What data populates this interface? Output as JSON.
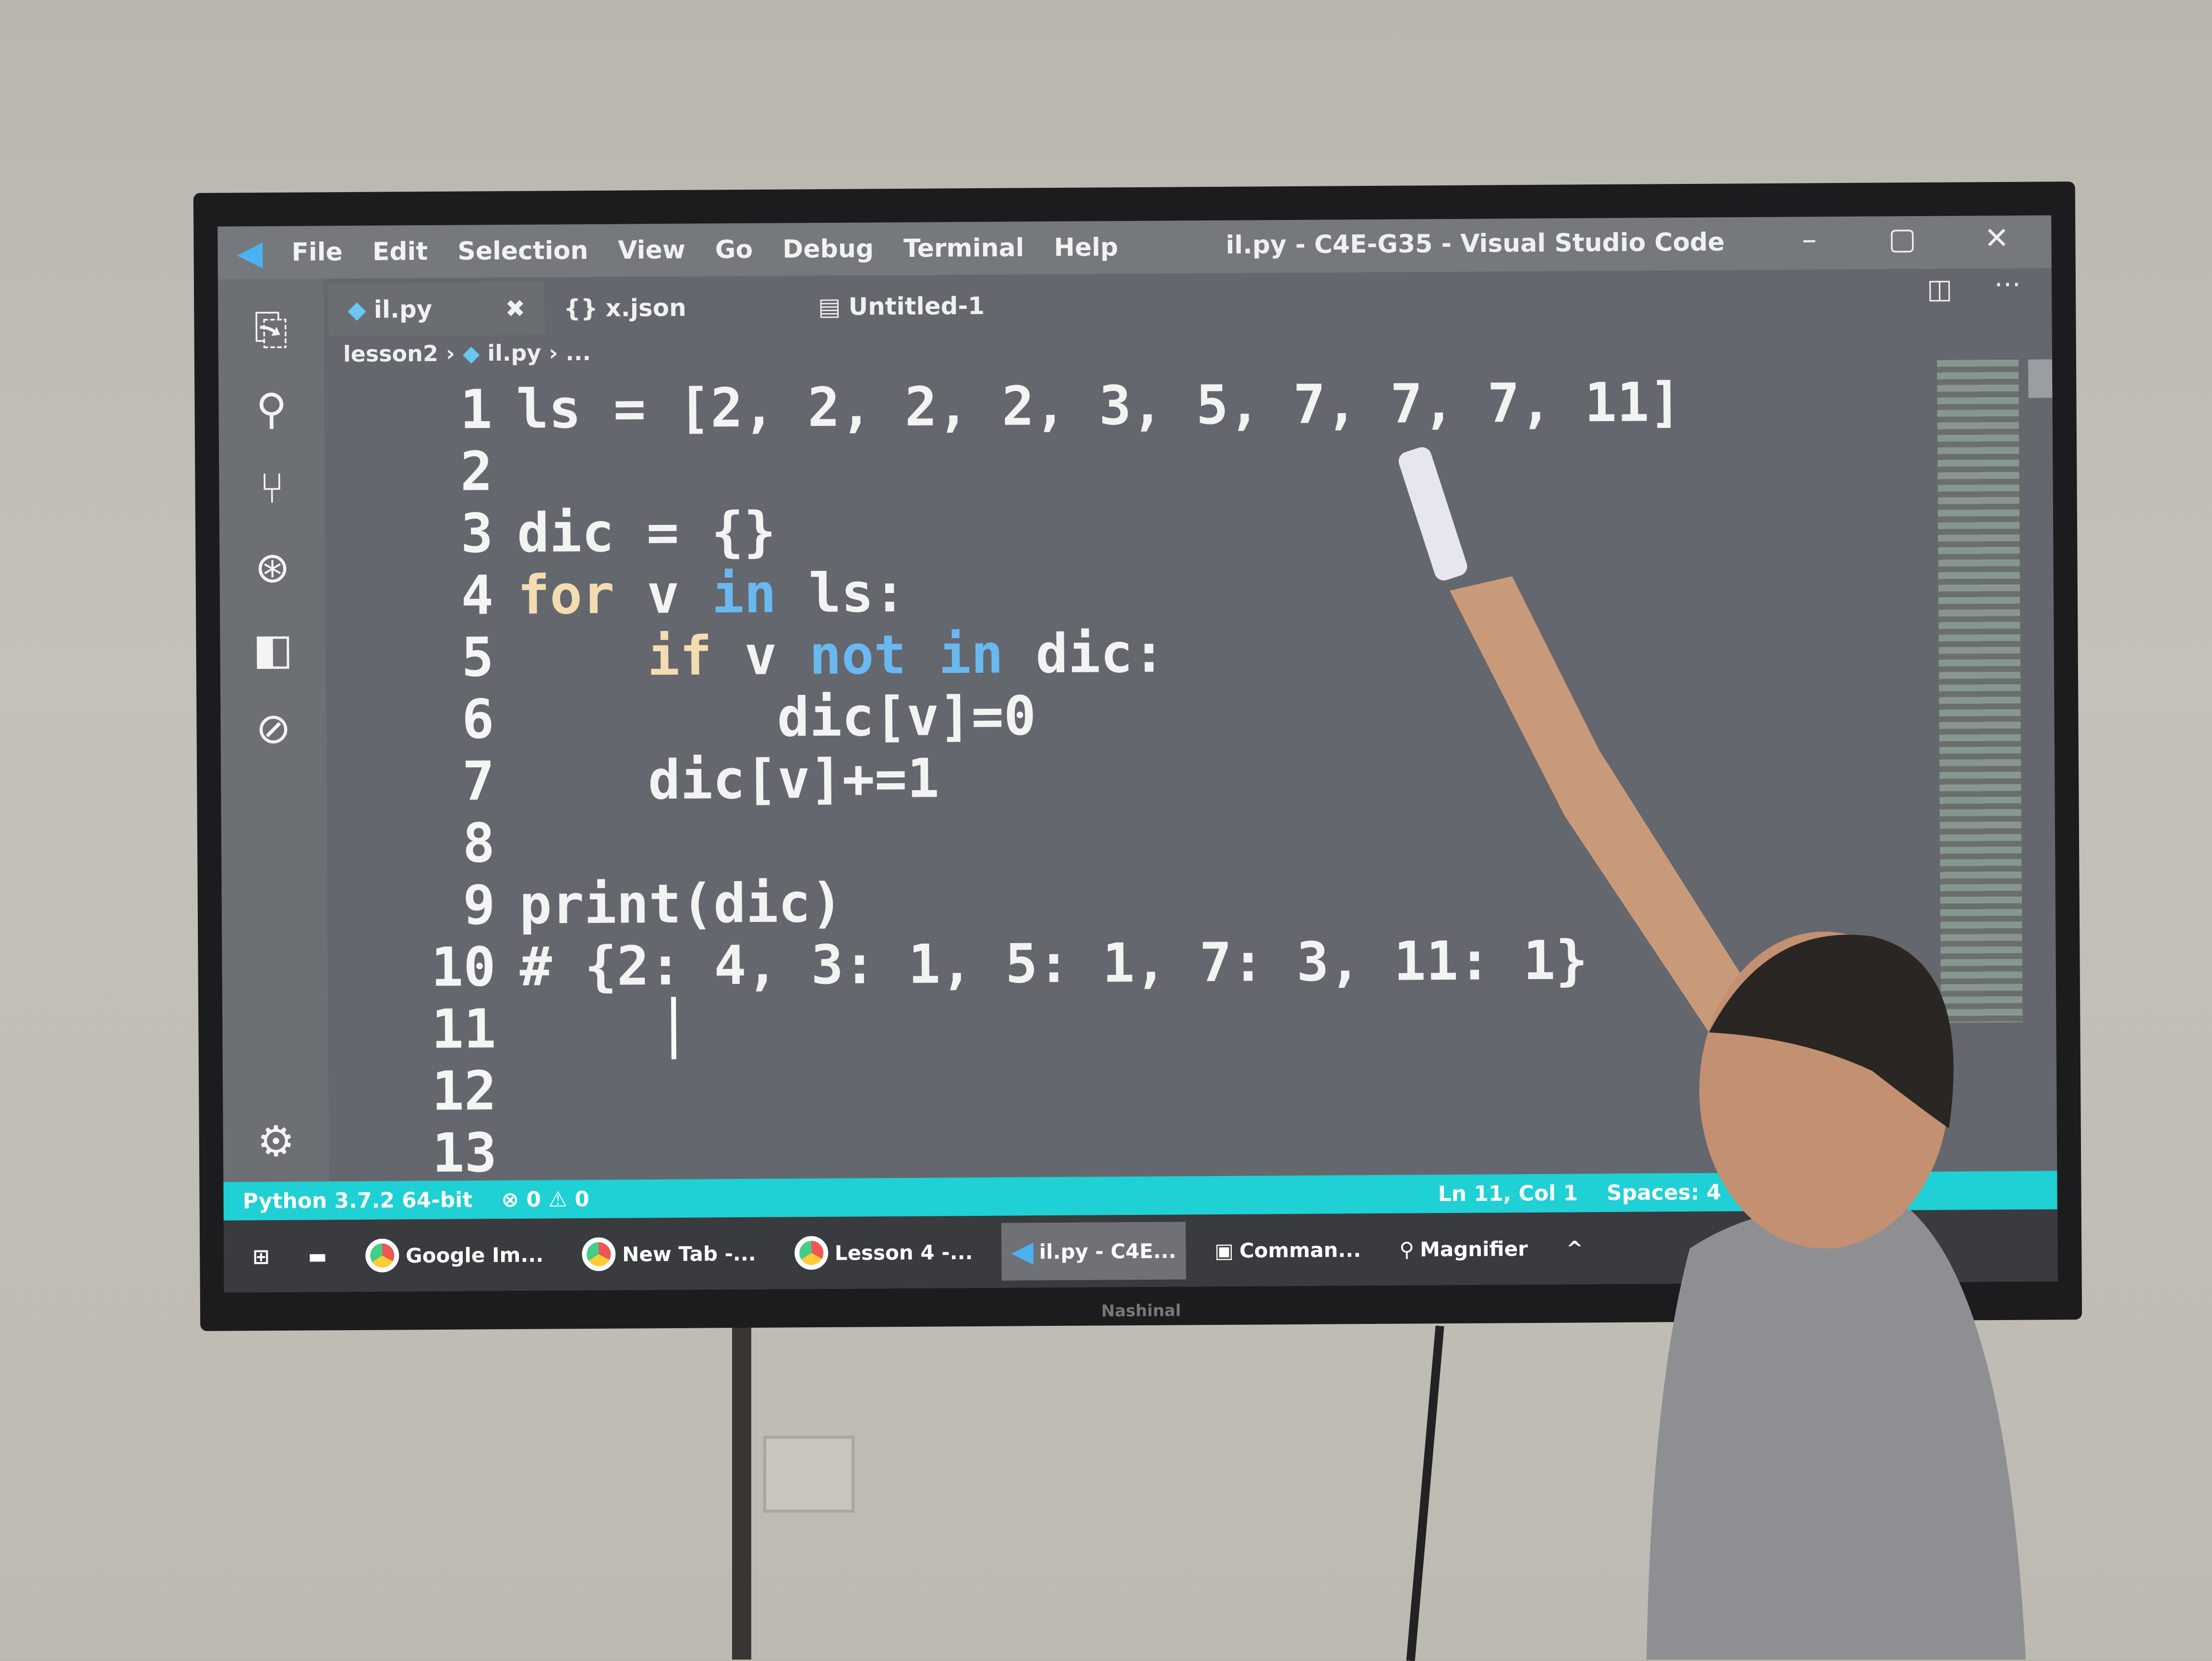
{
  "window": {
    "title": "il.py - C4E-G35 - Visual Studio Code",
    "menu": [
      "File",
      "Edit",
      "Selection",
      "View",
      "Go",
      "Debug",
      "Terminal",
      "Help"
    ]
  },
  "tabs": [
    {
      "label": "il.py",
      "icon": "python-file-icon",
      "active": true
    },
    {
      "label": "x.json",
      "icon": "json-braces-icon"
    },
    {
      "label": "Untitled-1",
      "icon": "file-icon"
    }
  ],
  "breadcrumb": [
    "lesson2",
    "il.py",
    "..."
  ],
  "activity_icons": [
    "explorer-icon",
    "search-icon",
    "source-control-icon",
    "debug-icon",
    "extensions-icon",
    "live-share-icon",
    "settings-gear-icon"
  ],
  "code": [
    {
      "n": "1",
      "t": "ls = [2, 2, 2, 2, 3, 5, 7, 7, 7, 11]"
    },
    {
      "n": "2",
      "t": ""
    },
    {
      "n": "3",
      "t": "dic = {}"
    },
    {
      "n": "4",
      "kw": "for",
      "a": " v ",
      "kb": "in",
      "b": " ls:"
    },
    {
      "n": "5",
      "indent": "    ",
      "kw": "if",
      "a": " v ",
      "kb": "not in",
      "b": " dic:"
    },
    {
      "n": "6",
      "t": "        dic[v]=0"
    },
    {
      "n": "7",
      "t": "    dic[v]+=1"
    },
    {
      "n": "8",
      "t": ""
    },
    {
      "n": "9",
      "t": "print(dic)"
    },
    {
      "n": "10",
      "t": "# {2: 4, 3: 1, 5: 1, 7: 3, 11: 1}"
    },
    {
      "n": "11",
      "t": ""
    },
    {
      "n": "12",
      "t": ""
    },
    {
      "n": "13",
      "t": ""
    }
  ],
  "status": {
    "interpreter": "Python 3.7.2 64-bit",
    "problems": "⊗ 0 ⚠ 0",
    "position": "Ln 11, Col 1",
    "spaces": "Spaces: 4"
  },
  "taskbar": [
    "Google Im...",
    "New Tab -...",
    "Lesson 4 -...",
    "il.py - C4E...",
    "Comman...",
    "Magnifier"
  ],
  "tv_brand": "Nashinal",
  "colors": {
    "status_bar": "#1fd0d4",
    "keyword": "#f3dcb2",
    "keyword_blue": "#69b9f0"
  }
}
